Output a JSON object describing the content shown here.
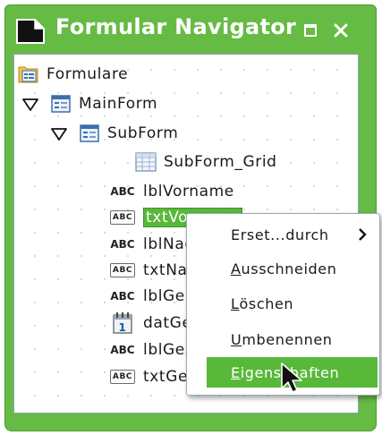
{
  "window": {
    "title": "Formular Navigator",
    "title_icon": "navigator-icon",
    "restore_icon": "undock-icon",
    "close_icon": "close-icon"
  },
  "tree": {
    "items": [
      {
        "label": "Formulare",
        "icon": "forms-folder-icon"
      },
      {
        "label": "MainForm",
        "icon": "form-icon",
        "expanded": true
      },
      {
        "label": "SubForm",
        "icon": "form-icon",
        "expanded": true
      },
      {
        "label": "SubForm_Grid",
        "icon": "table-grid-icon"
      },
      {
        "label": "lblVorname",
        "icon": "label-control-icon",
        "icon_text": "ABC"
      },
      {
        "label": "txtVorname",
        "icon": "textbox-control-icon",
        "icon_text": "ABC",
        "selected": true
      },
      {
        "label": "lblNach",
        "icon": "label-control-icon",
        "icon_text": "ABC"
      },
      {
        "label": "txtNach",
        "icon": "textbox-control-icon",
        "icon_text": "ABC"
      },
      {
        "label": "lblGeb",
        "icon": "label-control-icon",
        "icon_text": "ABC"
      },
      {
        "label": "datGeb",
        "icon": "date-control-icon",
        "icon_text": "1"
      },
      {
        "label": "lblGesc",
        "icon": "label-control-icon",
        "icon_text": "ABC"
      },
      {
        "label": "txtGesc",
        "icon": "textbox-control-icon",
        "icon_text": "ABC"
      }
    ]
  },
  "context_menu": {
    "items": [
      {
        "label_pre": "",
        "label_u": "",
        "label_post": "Erset...durch",
        "has_submenu": true
      },
      {
        "label_pre": "",
        "label_u": "A",
        "label_post": "usschneiden"
      },
      {
        "label_pre": "",
        "label_u": "L",
        "label_post": "öschen"
      },
      {
        "label_pre": "",
        "label_u": "U",
        "label_post": "mbenennen"
      },
      {
        "label_pre": "",
        "label_u": "E",
        "label_post": "igenschaften",
        "active": true
      }
    ]
  },
  "colors": {
    "accent": "#58b83a",
    "title_bar": "#66bb44",
    "text": "#1a1a1a"
  }
}
